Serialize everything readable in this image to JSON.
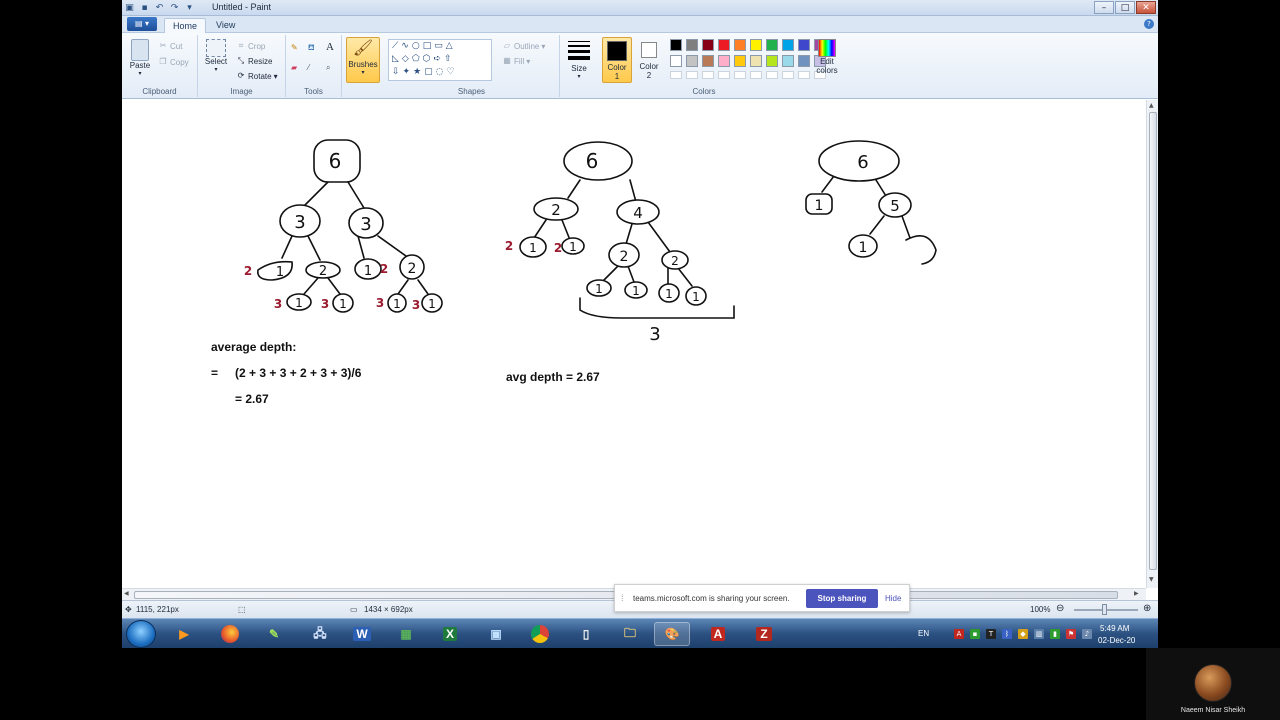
{
  "window": {
    "title": "Untitled - Paint",
    "controls": {
      "minimize": "–",
      "maximize": "□",
      "close": "✕"
    }
  },
  "tabs": {
    "home": "Home",
    "view": "View"
  },
  "ribbon": {
    "clipboard": {
      "label": "Clipboard",
      "paste": "Paste",
      "cut": "Cut",
      "copy": "Copy"
    },
    "image": {
      "label": "Image",
      "select": "Select",
      "crop": "Crop",
      "resize": "Resize",
      "rotate": "Rotate"
    },
    "tools": {
      "label": "Tools"
    },
    "brushes": {
      "label": "Brushes"
    },
    "shapes": {
      "label": "Shapes",
      "outline": "Outline",
      "fill": "Fill"
    },
    "size": {
      "label": "Size"
    },
    "colors": {
      "label": "Colors",
      "color1": "Color 1",
      "color2": "Color 2",
      "edit_colors": "Edit colors",
      "palette_row1": [
        "#000000",
        "#7f7f7f",
        "#880015",
        "#ed1c24",
        "#ff7f27",
        "#fff200",
        "#22b14c",
        "#00a2e8",
        "#3f48cc",
        "#a349a4"
      ],
      "palette_row2": [
        "#ffffff",
        "#c3c3c3",
        "#b97a57",
        "#ffaec9",
        "#ffc90e",
        "#efe4b0",
        "#b5e61d",
        "#99d9ea",
        "#7092be",
        "#c8bfe7"
      ],
      "color1_value": "#000000",
      "color2_value": "#ffffff"
    }
  },
  "canvas": {
    "tree1": {
      "root": "6",
      "level1": [
        "3",
        "3"
      ],
      "level2": [
        "1",
        "2",
        "1",
        "2"
      ],
      "level3": [
        "1",
        "1",
        "1",
        "1"
      ],
      "depths_red": [
        "2",
        "3",
        "3",
        "2",
        "3",
        "3"
      ]
    },
    "tree2": {
      "root": "6",
      "level1": [
        "2",
        "4"
      ],
      "level2": [
        "1",
        "1",
        "2",
        "2"
      ],
      "level3": [
        "1",
        "1",
        "1",
        "1"
      ],
      "depths_red": [
        "2",
        "2"
      ],
      "bracket_label": "3"
    },
    "tree3": {
      "root": "6",
      "level1": [
        "1",
        "5"
      ],
      "level2": [
        "1"
      ]
    },
    "notes": {
      "avg_heading": "average depth:",
      "equals": "=",
      "formula": "(2 + 3 + 3 + 2 + 3 + 3)/6",
      "result": "= 2.67",
      "avg_depth2": "avg depth = 2.67"
    }
  },
  "statusbar": {
    "cursor_pos": "1115, 221px",
    "canvas_size": "1434 × 692px",
    "zoom": "100%"
  },
  "share_banner": {
    "text": "teams.microsoft.com is sharing your screen.",
    "stop": "Stop sharing",
    "hide": "Hide"
  },
  "taskbar": {
    "lang": "EN",
    "time": "5:49 AM",
    "date": "02-Dec-20"
  },
  "camera": {
    "name": "Naeem Nisar Sheikh"
  }
}
